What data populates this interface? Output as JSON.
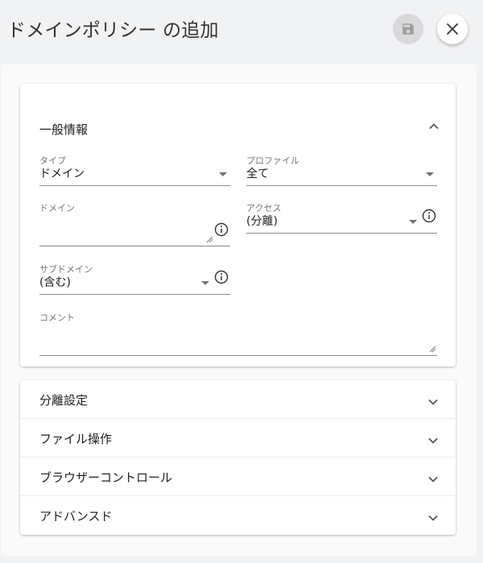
{
  "dialog": {
    "title": "ドメインポリシー の追加",
    "save_icon": "floppy-disk-icon",
    "close_icon": "close-x-icon"
  },
  "general": {
    "title": "一般情報",
    "expanded": true,
    "type": {
      "label": "タイプ",
      "value": "ドメイン"
    },
    "profile": {
      "label": "プロファイル",
      "value": "全て"
    },
    "domain": {
      "label": "ドメイン",
      "value": ""
    },
    "access": {
      "label": "アクセス",
      "value": "(分離)"
    },
    "subdomain": {
      "label": "サブドメイン",
      "value": "(含む)"
    },
    "comment": {
      "label": "コメント",
      "value": ""
    }
  },
  "sections": [
    {
      "label": "分離設定"
    },
    {
      "label": "ファイル操作"
    },
    {
      "label": "ブラウザーコントロール"
    },
    {
      "label": "アドバンスド"
    }
  ],
  "colors": {
    "background": "#f1f2f4",
    "card": "#ffffff",
    "text": "#212121",
    "label": "#757575"
  }
}
